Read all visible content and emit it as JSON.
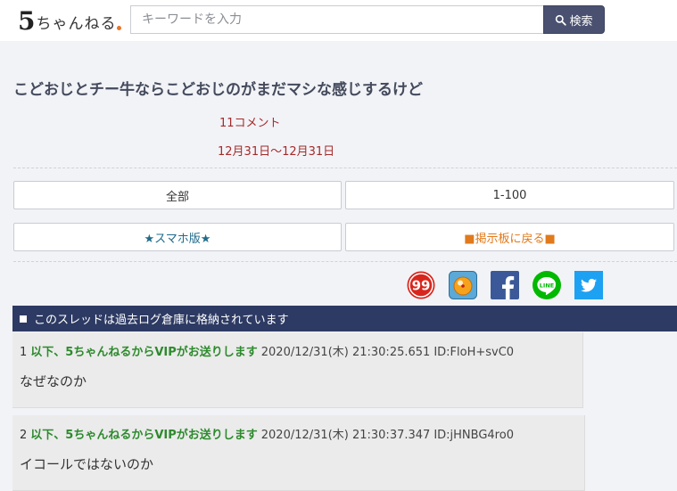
{
  "header": {
    "logo_five": "5",
    "logo_rest": "ちゃんねる",
    "search_placeholder": "キーワードを入力",
    "search_button_label": "検索"
  },
  "thread": {
    "title": "こどおじとチー牛ならこどおじのがまだマシな感じするけど",
    "comment_count": "11コメント",
    "date_range": "12月31日～12月31日"
  },
  "nav": {
    "all_label": "全部",
    "range_label": "1-100",
    "smartphone_label": "★スマホ版★",
    "board_label": "■掲示板に戻る■"
  },
  "share": {
    "ninety_nine_text": "99",
    "line_text": "LINE"
  },
  "archive_notice": "このスレッドは過去ログ倉庫に格納されています",
  "colors": {
    "header_bg": "#ffffff",
    "page_bg": "#f2f3f7",
    "banner_bg": "#2d3a63",
    "search_button_bg": "#4a5170",
    "name_green": "#2d8a2d",
    "meta_red": "#a52a2a",
    "board_orange": "#e07a1c",
    "smartphone_blue": "#1f6b8c",
    "facebook_blue": "#3b5998",
    "line_green": "#00b900",
    "twitter_blue": "#1da1f2"
  },
  "posts": [
    {
      "number": "1",
      "name": "以下、5ちゃんねるからVIPがお送りします",
      "date": "2020/12/31(木) 21:30:25.651",
      "id": "ID:FloH+svC0",
      "body": "なぜなのか"
    },
    {
      "number": "2",
      "name": "以下、5ちゃんねるからVIPがお送りします",
      "date": "2020/12/31(木) 21:30:37.347",
      "id": "ID:jHNBG4ro0",
      "body": "イコールではないのか"
    }
  ]
}
